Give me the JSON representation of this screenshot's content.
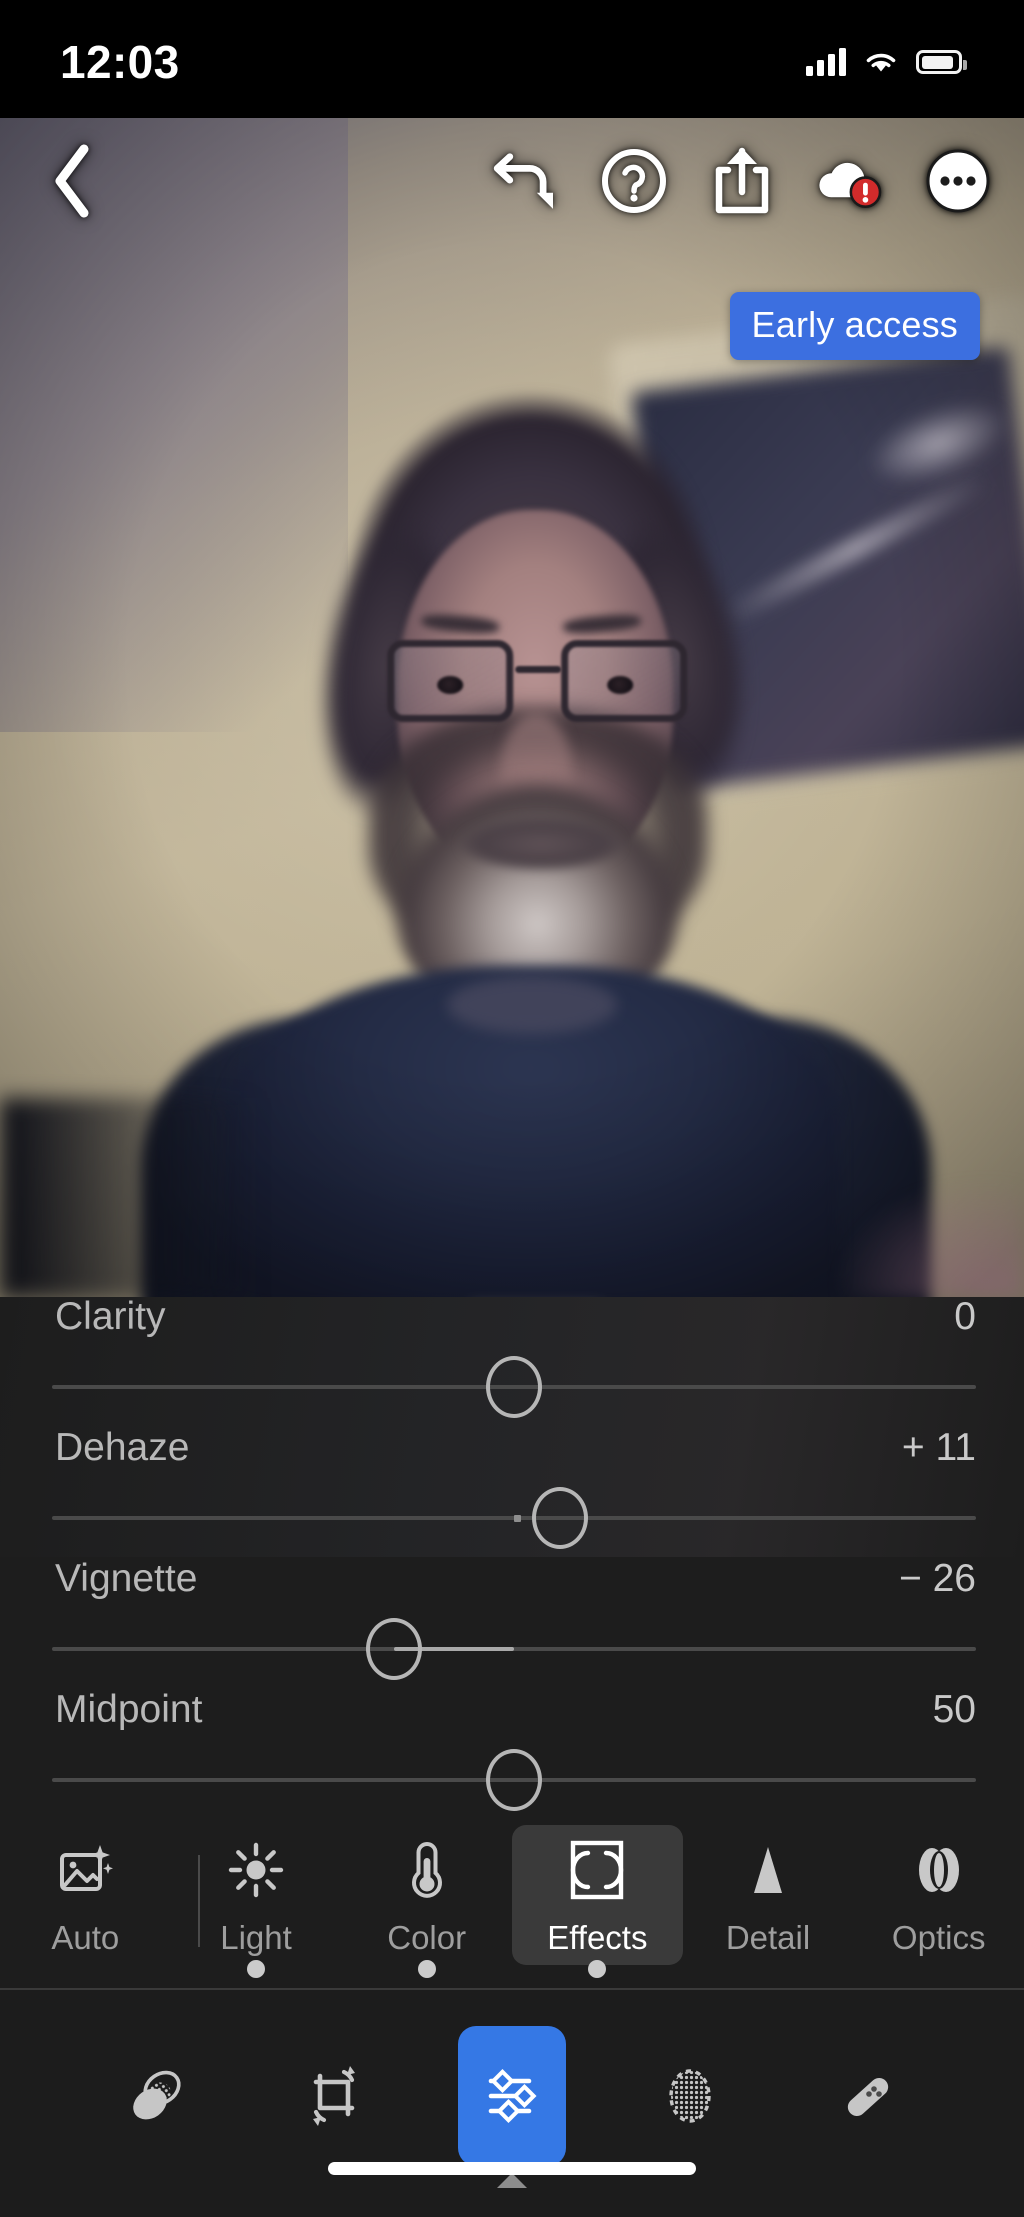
{
  "status_bar": {
    "time": "12:03",
    "signal_icon": "cellular-signal-icon",
    "wifi_icon": "wifi-icon",
    "battery_icon": "battery-icon"
  },
  "top_toolbar": {
    "back_icon": "back-chevron-icon",
    "actions": [
      {
        "name": "undo-icon",
        "label": "Undo"
      },
      {
        "name": "help-icon",
        "label": "Help"
      },
      {
        "name": "share-icon",
        "label": "Share"
      },
      {
        "name": "cloud-sync-error-icon",
        "label": "Cloud sync error"
      },
      {
        "name": "more-options-icon",
        "label": "More"
      }
    ]
  },
  "badge": {
    "label": "Early access",
    "color": "#3c6fe0"
  },
  "photo": {
    "description": "Portrait photo of a bearded man wearing glasses in front of a beige wall with a blurred framed picture on the right"
  },
  "adjustments": {
    "panel_name": "Effects",
    "sliders": [
      {
        "label": "Clarity",
        "value": "0",
        "position": 50.0,
        "fill_from": 50.0,
        "fill_to": 50.0,
        "clipped": true
      },
      {
        "label": "Dehaze",
        "value": "+ 11",
        "position": 55.0,
        "fill_from": 50.0,
        "fill_to": 50.0
      },
      {
        "label": "Vignette",
        "value": "− 26",
        "position": 37.0,
        "fill_from": 37.0,
        "fill_to": 50.0
      },
      {
        "label": "Midpoint",
        "value": "50",
        "position": 50.0,
        "fill_from": 50.0,
        "fill_to": 50.0
      }
    ]
  },
  "edit_tabs": {
    "items": [
      {
        "label": "Auto",
        "icon": "auto-enhance-icon",
        "selected": false,
        "has_dot": false
      },
      {
        "label": "Light",
        "icon": "sun-icon",
        "selected": false,
        "has_dot": true
      },
      {
        "label": "Color",
        "icon": "thermometer-icon",
        "selected": false,
        "has_dot": true
      },
      {
        "label": "Effects",
        "icon": "effects-frame-icon",
        "selected": true,
        "has_dot": true
      },
      {
        "label": "Detail",
        "icon": "triangle-detail-icon",
        "selected": false,
        "has_dot": false
      },
      {
        "label": "Optics",
        "icon": "lens-optics-icon",
        "selected": false,
        "has_dot": false
      }
    ]
  },
  "bottom_bar": {
    "items": [
      {
        "name": "presets-icon",
        "label": "Presets",
        "selected": false
      },
      {
        "name": "crop-icon",
        "label": "Crop",
        "selected": false
      },
      {
        "name": "edit-sliders-icon",
        "label": "Edit",
        "selected": true
      },
      {
        "name": "masking-icon",
        "label": "Masking",
        "selected": false
      },
      {
        "name": "healing-icon",
        "label": "Healing",
        "selected": false
      }
    ],
    "selected_color": "#3578e5",
    "home_indicator": "home-indicator"
  }
}
